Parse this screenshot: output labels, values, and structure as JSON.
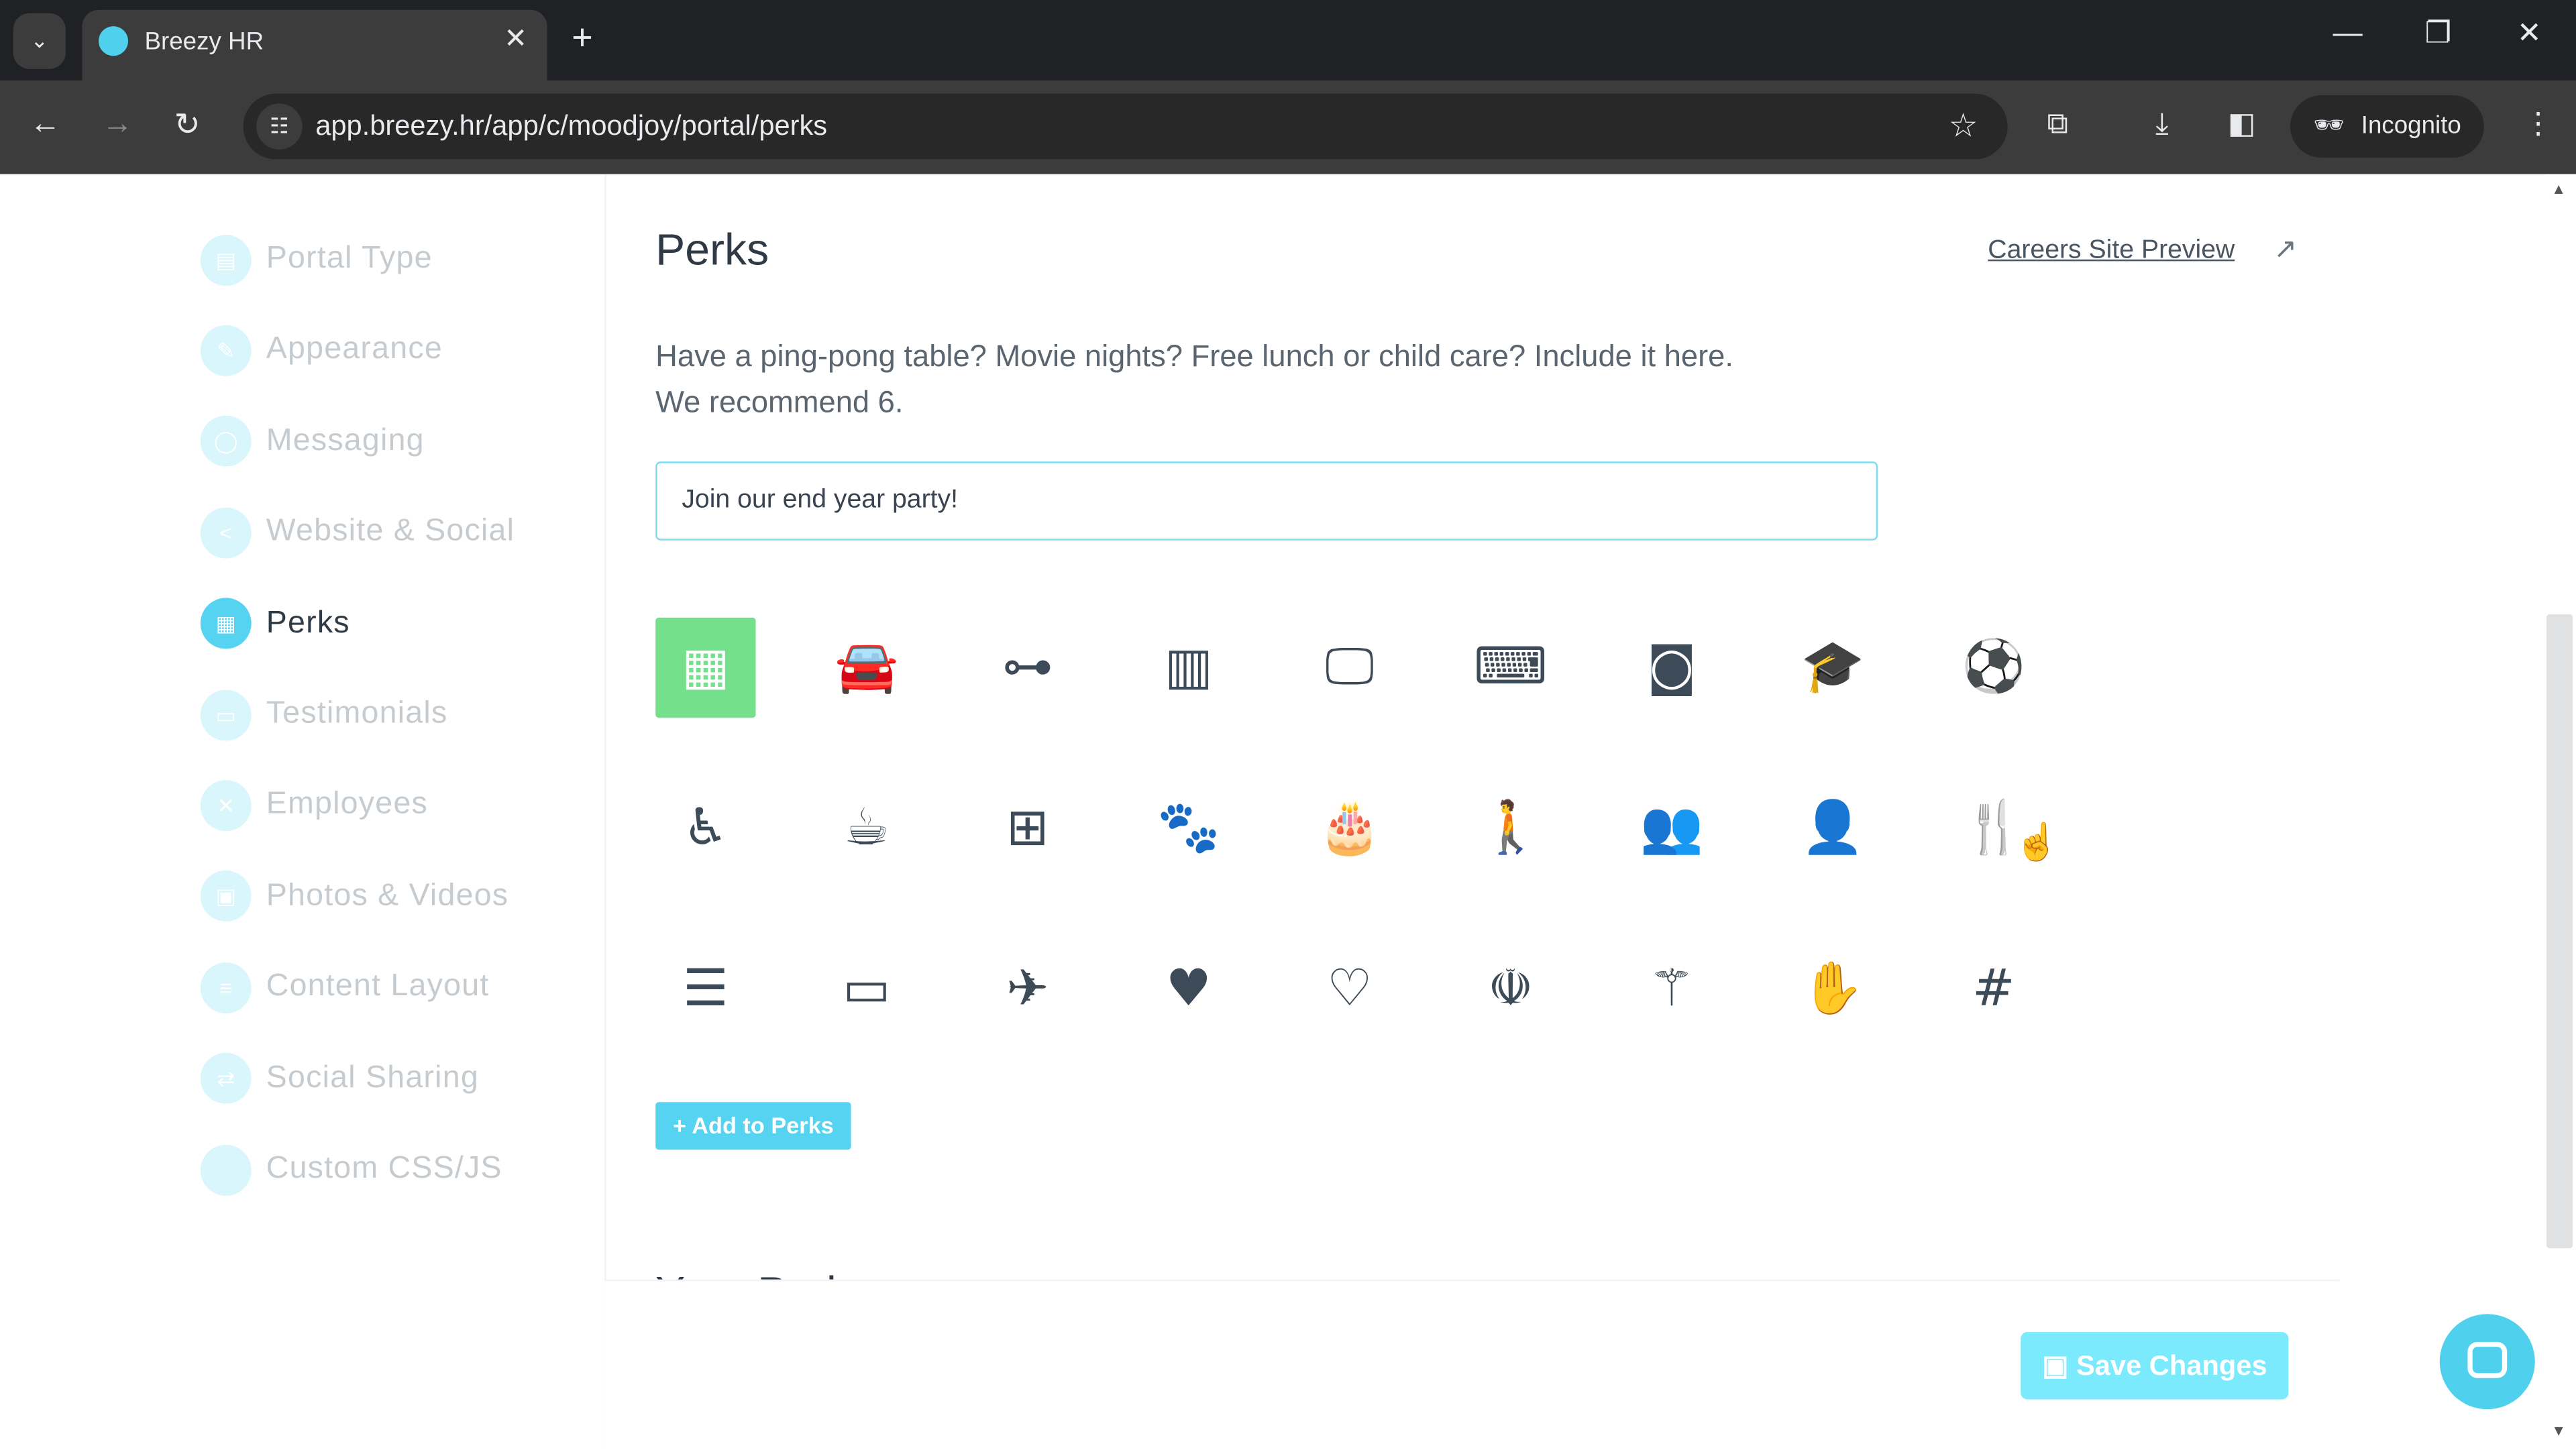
{
  "browser": {
    "tab_title": "Breezy HR",
    "url": "app.breezy.hr/app/c/moodjoy/portal/perks",
    "profile_label": "Incognito"
  },
  "sidebar": {
    "items": [
      {
        "label": "Portal Type",
        "icon": "table-icon",
        "active": false
      },
      {
        "label": "Appearance",
        "icon": "brush-icon",
        "active": false
      },
      {
        "label": "Messaging",
        "icon": "comment-icon",
        "active": false
      },
      {
        "label": "Website & Social",
        "icon": "share-icon",
        "active": false
      },
      {
        "label": "Perks",
        "icon": "gift-icon",
        "active": true
      },
      {
        "label": "Testimonials",
        "icon": "comments-icon",
        "active": false
      },
      {
        "label": "Employees",
        "icon": "users-icon",
        "active": false
      },
      {
        "label": "Photos & Videos",
        "icon": "image-icon",
        "active": false
      },
      {
        "label": "Content Layout",
        "icon": "list-icon",
        "active": false
      },
      {
        "label": "Social Sharing",
        "icon": "retweet-icon",
        "active": false
      },
      {
        "label": "Custom CSS/JS",
        "icon": "code-icon",
        "active": false
      }
    ]
  },
  "main": {
    "title": "Perks",
    "preview_link": "Careers Site Preview",
    "description_line1": "Have a ping-pong table? Movie nights? Free lunch or child care? Include it here.",
    "description_line2": "We recommend 6.",
    "perk_input_value": "Join our end year party!",
    "add_button": "+ Add to Perks",
    "your_perks_heading": "Your Perks",
    "save_button": "Save Changes",
    "selected_icon": "gift",
    "icons": [
      [
        "gift",
        "car",
        "gamepad",
        "film",
        "desktop",
        "laptop",
        "money",
        "graduation-cap",
        "soccer-ball"
      ],
      [
        "wheelchair",
        "coffee",
        "medkit",
        "paw",
        "birthday-cake",
        "child",
        "users",
        "user",
        "cutlery"
      ],
      [
        "bar-chart",
        "ticket",
        "plane",
        "heart",
        "heartbeat",
        "rebel",
        "pied-piper",
        "hand-spock",
        "slack"
      ]
    ]
  },
  "colors": {
    "accent": "#55d3f1",
    "selected_icon_bg": "#74e08c",
    "save_button": "#7aeafc"
  }
}
